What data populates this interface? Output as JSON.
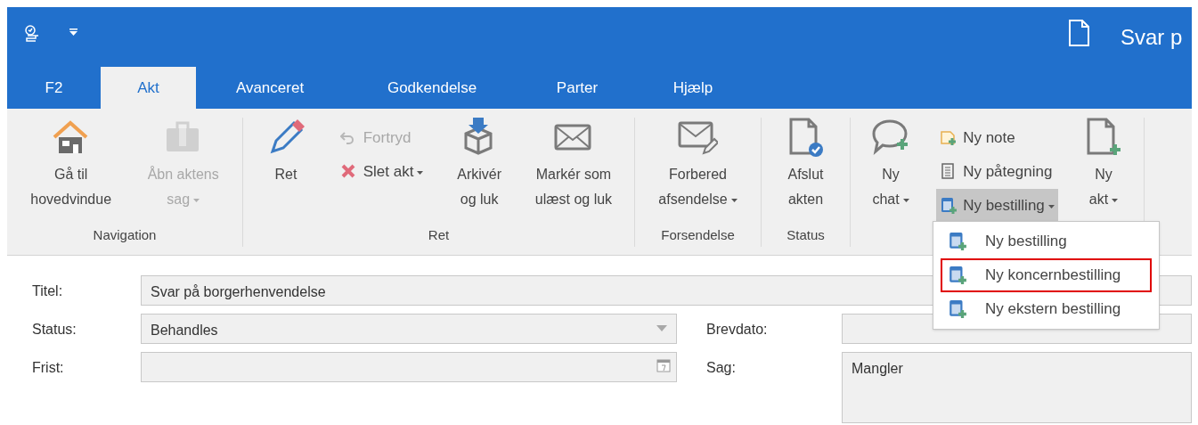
{
  "window": {
    "title": "Svar p"
  },
  "tabs": [
    {
      "label": "F2",
      "selected": false
    },
    {
      "label": "Akt",
      "selected": true
    },
    {
      "label": "Avanceret",
      "selected": false
    },
    {
      "label": "Godkendelse",
      "selected": false
    },
    {
      "label": "Parter",
      "selected": false
    },
    {
      "label": "Hjælp",
      "selected": false
    }
  ],
  "ribbon": {
    "groups": [
      {
        "label": "Navigation",
        "items": [
          {
            "kind": "large",
            "lines": [
              "Gå til",
              "hovedvindue"
            ],
            "disabled": false,
            "dropdown": false
          },
          {
            "kind": "large",
            "lines": [
              "Åbn aktens",
              "sag"
            ],
            "disabled": true,
            "dropdown": true
          }
        ]
      },
      {
        "label": "Ret",
        "items": [
          {
            "kind": "large",
            "lines": [
              "Ret"
            ],
            "disabled": false,
            "dropdown": false
          },
          {
            "kind": "stack",
            "items": [
              {
                "label": "Fortryd",
                "disabled": true,
                "dropdown": false,
                "pressed": false
              },
              {
                "label": "Slet akt",
                "disabled": false,
                "dropdown": true,
                "pressed": false
              }
            ]
          },
          {
            "kind": "large",
            "lines": [
              "Arkivér",
              "og luk"
            ],
            "disabled": false,
            "dropdown": false
          },
          {
            "kind": "large",
            "lines": [
              "Markér som",
              "ulæst og luk"
            ],
            "disabled": false,
            "dropdown": false
          }
        ]
      },
      {
        "label": "Forsendelse",
        "items": [
          {
            "kind": "large",
            "lines": [
              "Forbered",
              "afsendelse"
            ],
            "disabled": false,
            "dropdown": true
          }
        ]
      },
      {
        "label": "Status",
        "items": [
          {
            "kind": "large",
            "lines": [
              "Afslut",
              "akten"
            ],
            "disabled": false,
            "dropdown": false
          }
        ]
      },
      {
        "items": [
          {
            "kind": "large",
            "lines": [
              "Ny",
              "chat"
            ],
            "disabled": false,
            "dropdown": true
          },
          {
            "kind": "stack",
            "items": [
              {
                "label": "Ny note",
                "disabled": false,
                "dropdown": false,
                "pressed": false
              },
              {
                "label": "Ny påtegning",
                "disabled": false,
                "dropdown": false,
                "pressed": false
              },
              {
                "label": "Ny bestilling",
                "disabled": false,
                "dropdown": true,
                "pressed": true
              }
            ]
          },
          {
            "kind": "large",
            "lines": [
              "Ny",
              "akt"
            ],
            "disabled": false,
            "dropdown": true
          }
        ]
      }
    ]
  },
  "open_menu": {
    "items": [
      {
        "label": "Ny bestilling",
        "outlined": false
      },
      {
        "label": "Ny koncernbestilling",
        "outlined": true
      },
      {
        "label": "Ny ekstern bestilling",
        "outlined": false
      }
    ]
  },
  "form": {
    "fields": [
      {
        "label": "Titel:",
        "kind": "text",
        "value": "Svar på borgerhenvendelse"
      },
      {
        "label": "Status:",
        "kind": "select",
        "value": "Behandles"
      },
      {
        "label": "Brevdato:",
        "kind": "text"
      },
      {
        "label": "Frist:",
        "kind": "date"
      },
      {
        "label": "Sag:",
        "kind": "textarea",
        "value": "Mangler"
      }
    ]
  }
}
